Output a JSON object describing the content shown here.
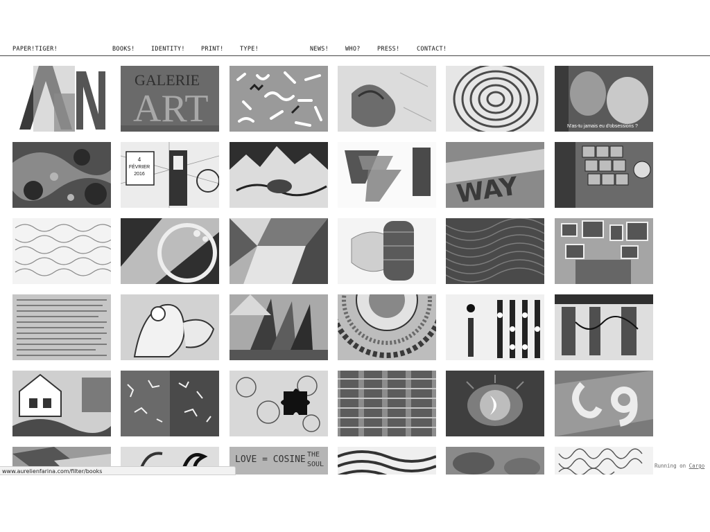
{
  "nav": {
    "brand": "PAPER!TIGER!",
    "items": [
      "BOOKS!",
      "IDENTITY!",
      "PRINT!",
      "TYPE!",
      "NEWS!",
      "WHO?",
      "PRESS!",
      "CONTACT!"
    ]
  },
  "tiles": {
    "t1_2_title_1": "GALERIE",
    "t1_2_title_2": "ART",
    "t1_6_caption": "N'as-tu jamais eu d'obsessions ?",
    "t2_2_date_1": "4",
    "t2_2_date_2": "FÉVRIER",
    "t2_2_date_3": "2016",
    "t2_5_word": "WAY",
    "t6_3_text_1": "LOVE = COSINE",
    "t6_3_text_2": "THE",
    "t6_3_text_3": "SOUL"
  },
  "footer": {
    "prefix": "Running on",
    "link": "Cargo"
  },
  "status_bar": {
    "url": "www.aurelienfarina.com/filter/books"
  },
  "colors": {
    "background": "#ffffff",
    "text": "#111111",
    "rule": "#444444"
  }
}
